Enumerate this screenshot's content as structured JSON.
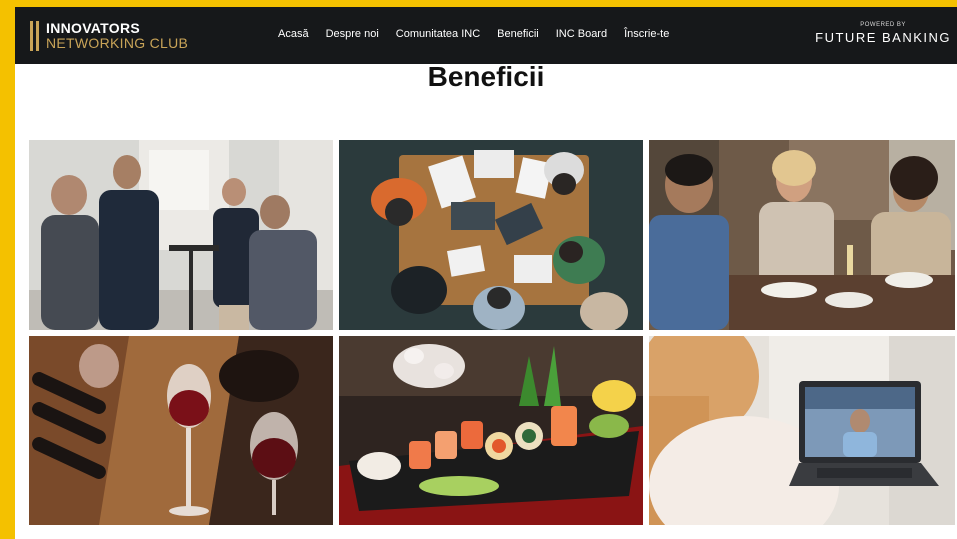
{
  "brand": {
    "line1": "INNOVATORS",
    "line2": "NETWORKING CLUB",
    "accent_color": "#c9a458"
  },
  "nav": {
    "items": [
      {
        "label": "Acasă"
      },
      {
        "label": "Despre noi"
      },
      {
        "label": "Comunitatea INC"
      },
      {
        "label": "Beneficii"
      },
      {
        "label": "INC Board"
      },
      {
        "label": "Înscrie-te"
      }
    ]
  },
  "partner": {
    "powered_by": "POWERED BY",
    "name": "FUTURE BANKING"
  },
  "page": {
    "title": "Beneficii"
  },
  "colors": {
    "frame": "#f4c100",
    "navbar": "#16181a",
    "page_background": "#ffffff"
  },
  "gallery": {
    "images": [
      {
        "subject": "business-networking-photo"
      },
      {
        "subject": "team-meeting-overhead-photo"
      },
      {
        "subject": "restaurant-dinner-photo"
      },
      {
        "subject": "wine-tasting-photo"
      },
      {
        "subject": "sushi-platter-photo"
      },
      {
        "subject": "video-call-photo"
      }
    ]
  }
}
